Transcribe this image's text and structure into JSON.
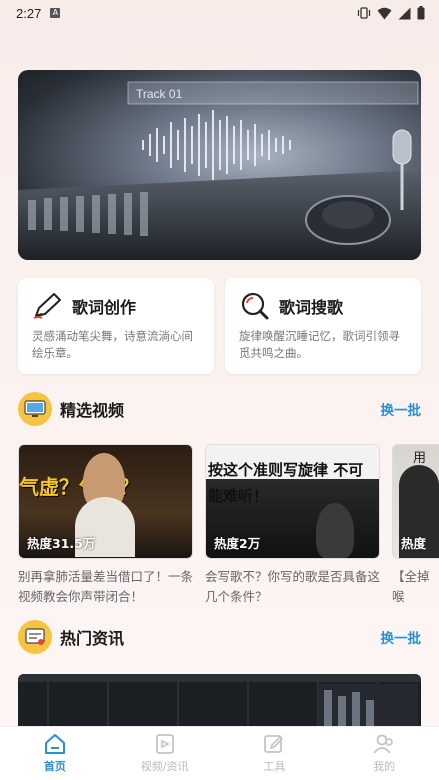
{
  "status": {
    "time": "2:27"
  },
  "cards": [
    {
      "title": "歌词创作",
      "desc": "灵感涌动笔尖舞，诗意流淌心间绘乐章。",
      "icon": "pen-icon"
    },
    {
      "title": "歌词搜歌",
      "desc": "旋律唤醒沉睡记忆，歌词引领寻觅共鸣之曲。",
      "icon": "search-icon"
    }
  ],
  "featured": {
    "title": "精选视频",
    "more": "换一批",
    "videos": [
      {
        "heat": "热度31.5万",
        "title": "别再拿肺活量差当借口了！一条视频教会你声带闭合！",
        "thumb_text": "气虚？气短？"
      },
      {
        "heat": "热度2万",
        "title": "会写歌不？你写的歌是否具备这几个条件？",
        "thumb_text": "按这个准则写旋律 不可能难听！"
      },
      {
        "heat": "热度",
        "title": "【全掉喉",
        "thumb_text": "用"
      }
    ]
  },
  "news": {
    "title": "热门资讯",
    "more": "换一批"
  },
  "nav": [
    {
      "label": "首页",
      "icon": "home-icon",
      "active": true
    },
    {
      "label": "视频/资讯",
      "icon": "video-icon",
      "active": false
    },
    {
      "label": "工具",
      "icon": "tools-icon",
      "active": false
    },
    {
      "label": "我的",
      "icon": "profile-icon",
      "active": false
    }
  ],
  "colors": {
    "accent": "#2b8fd6",
    "section_icon_bg": "#f5c440"
  }
}
